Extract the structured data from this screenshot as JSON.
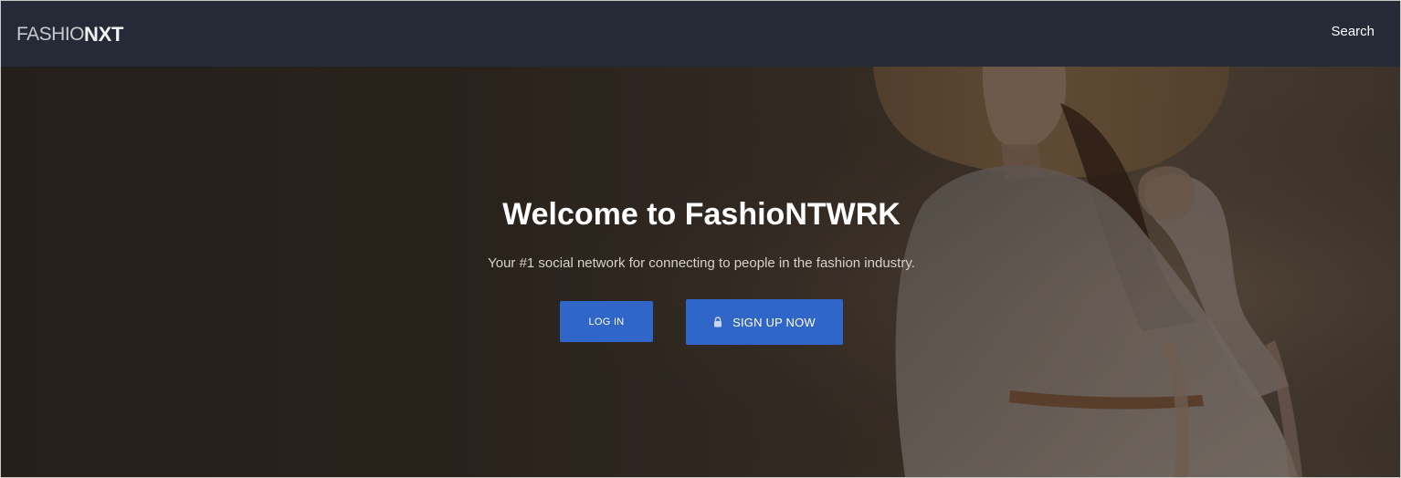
{
  "navbar": {
    "logo_light": "FASHIO",
    "logo_bold": "NXT",
    "search_label": "Search"
  },
  "hero": {
    "title": "Welcome to FashioNTWRK",
    "subtitle": "Your #1 social network for connecting to people in the fashion industry.",
    "login_label": "LOG IN",
    "signup_label": "SIGN UP NOW",
    "signup_icon": "lock-icon",
    "background_image": "woman-in-white-dress-with-sun-hat-photo"
  },
  "colors": {
    "navbar_bg": "#262a37",
    "button_blue": "#2f66c8",
    "title_text": "#ffffff"
  }
}
